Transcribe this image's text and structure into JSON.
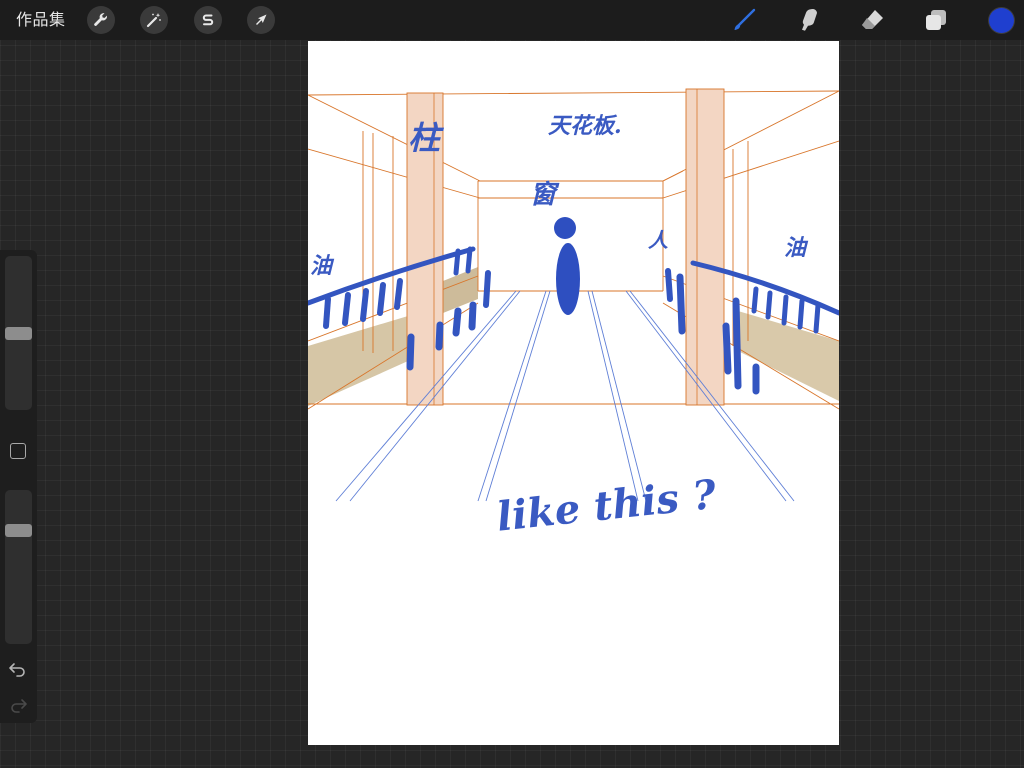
{
  "topbar": {
    "gallery_label": "作品集",
    "tools_left": [
      {
        "name": "actions",
        "icon": "wrench-icon"
      },
      {
        "name": "adjustments",
        "icon": "magic-wand-icon"
      },
      {
        "name": "selection",
        "icon": "selection-s-icon"
      },
      {
        "name": "transform",
        "icon": "arrow-cursor-icon"
      }
    ],
    "tools_right": [
      {
        "name": "brush",
        "icon": "brush-icon",
        "active": true
      },
      {
        "name": "smudge",
        "icon": "smudge-finger-icon",
        "active": false
      },
      {
        "name": "eraser",
        "icon": "eraser-icon",
        "active": false
      },
      {
        "name": "layers",
        "icon": "layers-icon",
        "active": false
      }
    ],
    "current_color": "#1f3fcf",
    "active_tool_color": "#2f6fe0"
  },
  "sidebar": {
    "brush_size": 0.5,
    "opacity": 0.76,
    "modify_icon": "square-icon",
    "undo_icon": "undo-icon",
    "redo_icon": "redo-icon"
  },
  "canvas": {
    "annotations": {
      "ceiling": "天花板.",
      "pillar": "柱",
      "window": "窗",
      "person": "人",
      "railing_left": "油",
      "railing_right": "油",
      "caption": "like this ?"
    },
    "colors": {
      "ink": "#3355c0",
      "perspective_line": "#d8752a",
      "pillar_fill": "#f3d6c3",
      "wall_fill": "#cdbb9a"
    }
  }
}
